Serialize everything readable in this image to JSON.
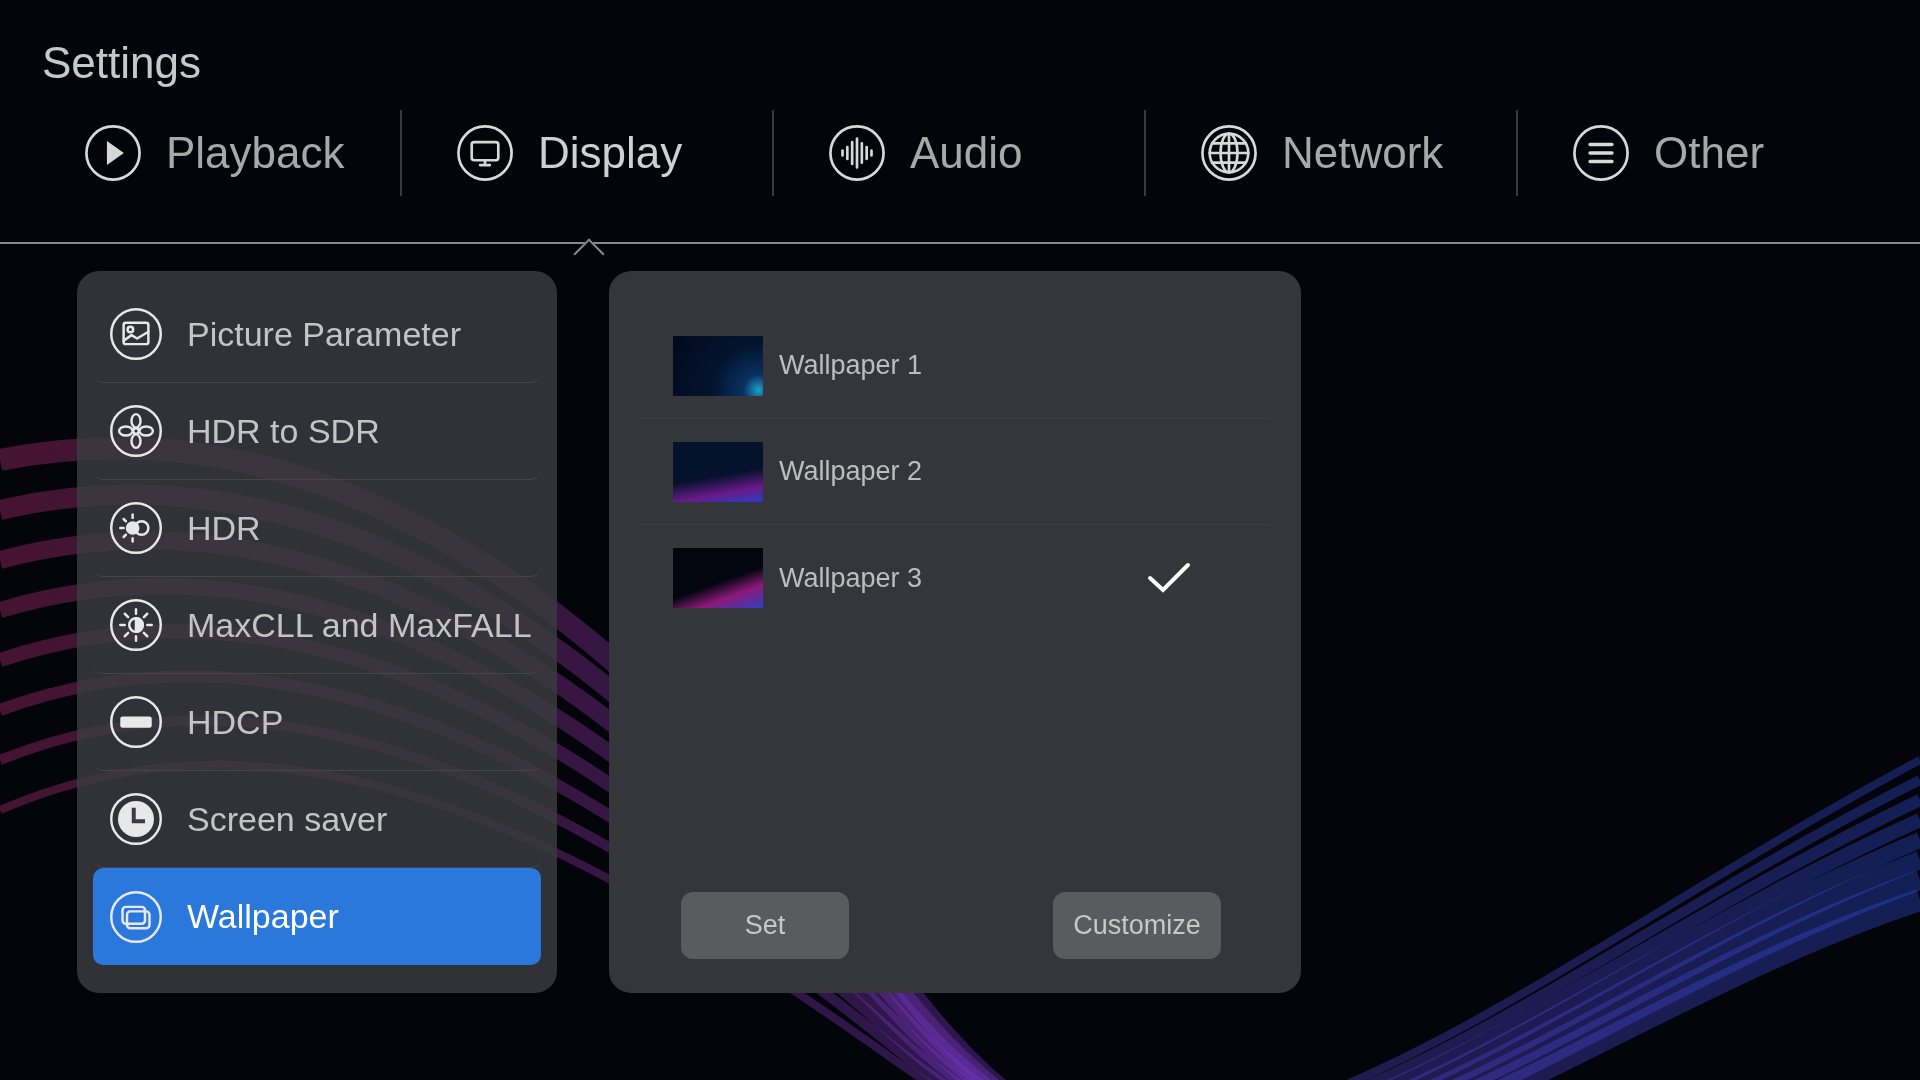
{
  "title": "Settings",
  "tabs": [
    {
      "label": "Playback",
      "selected": false
    },
    {
      "label": "Display",
      "selected": true
    },
    {
      "label": "Audio",
      "selected": false
    },
    {
      "label": "Network",
      "selected": false
    },
    {
      "label": "Other",
      "selected": false
    }
  ],
  "menu": [
    {
      "label": "Picture Parameter",
      "selected": false
    },
    {
      "label": "HDR to SDR",
      "selected": false
    },
    {
      "label": "HDR",
      "selected": false
    },
    {
      "label": "MaxCLL and MaxFALL",
      "selected": false
    },
    {
      "label": "HDCP",
      "selected": false
    },
    {
      "label": "Screen saver",
      "selected": false
    },
    {
      "label": "Wallpaper",
      "selected": true
    }
  ],
  "wallpapers": [
    {
      "label": "Wallpaper 1",
      "checked": false
    },
    {
      "label": "Wallpaper 2",
      "checked": false
    },
    {
      "label": "Wallpaper 3",
      "checked": true
    }
  ],
  "buttons": [
    "Set",
    "Customize"
  ]
}
